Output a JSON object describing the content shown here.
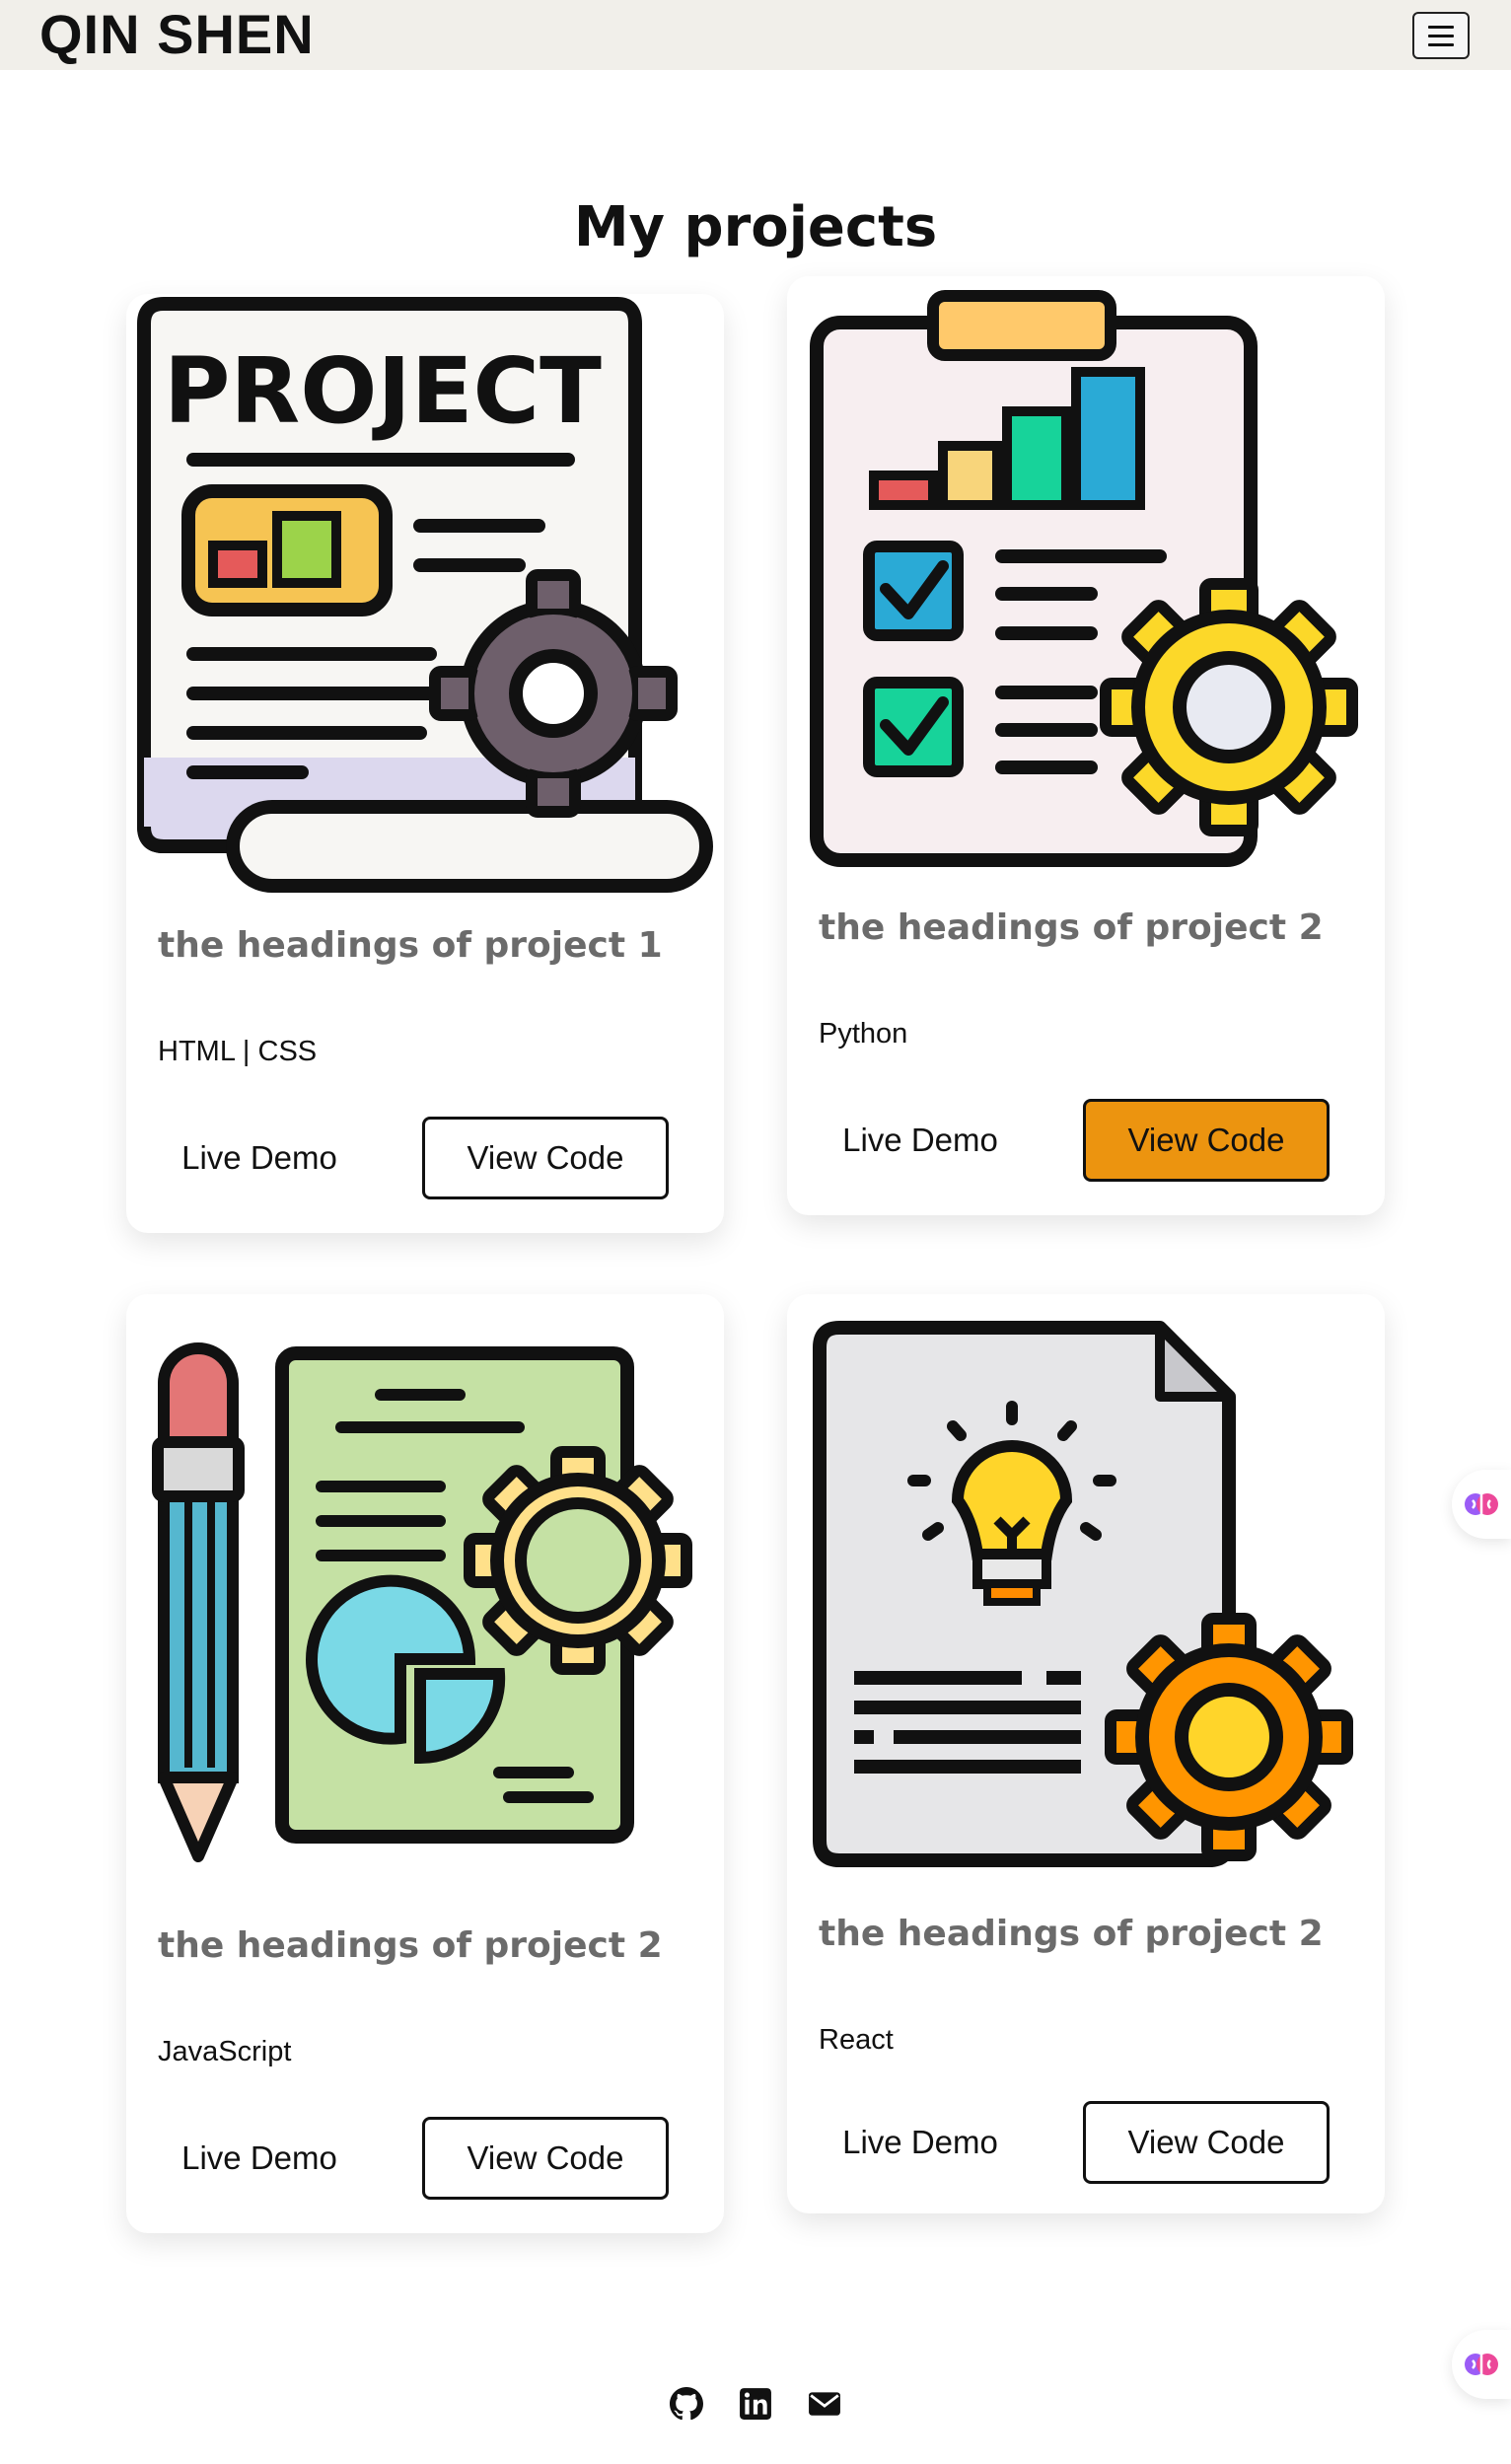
{
  "navbar": {
    "brand": "QIN SHEN",
    "menu_icon": "hamburger-icon"
  },
  "page_title": "My projects",
  "projects": [
    {
      "heading": "the headings of project 1",
      "tech": "HTML | CSS",
      "live_demo": "Live Demo",
      "view_code": "View Code",
      "illustration": "project-document-gear-icon"
    },
    {
      "heading": "the headings of project 2",
      "tech": "Python",
      "live_demo": "Live Demo",
      "view_code": "View Code",
      "illustration": "clipboard-chart-gear-icon"
    },
    {
      "heading": "the headings of project 2",
      "tech": "JavaScript",
      "live_demo": "Live Demo",
      "view_code": "View Code",
      "illustration": "pencil-report-gear-icon"
    },
    {
      "heading": "the headings of project 2",
      "tech": "React",
      "live_demo": "Live Demo",
      "view_code": "View Code",
      "illustration": "idea-document-gear-icon"
    }
  ],
  "footer": {
    "icons": [
      "github-icon",
      "linkedin-icon",
      "mail-icon"
    ]
  },
  "colors": {
    "navbar_bg": "#f1efea",
    "heading_gray": "#6b6b6b",
    "active_button": "#ec940f"
  }
}
